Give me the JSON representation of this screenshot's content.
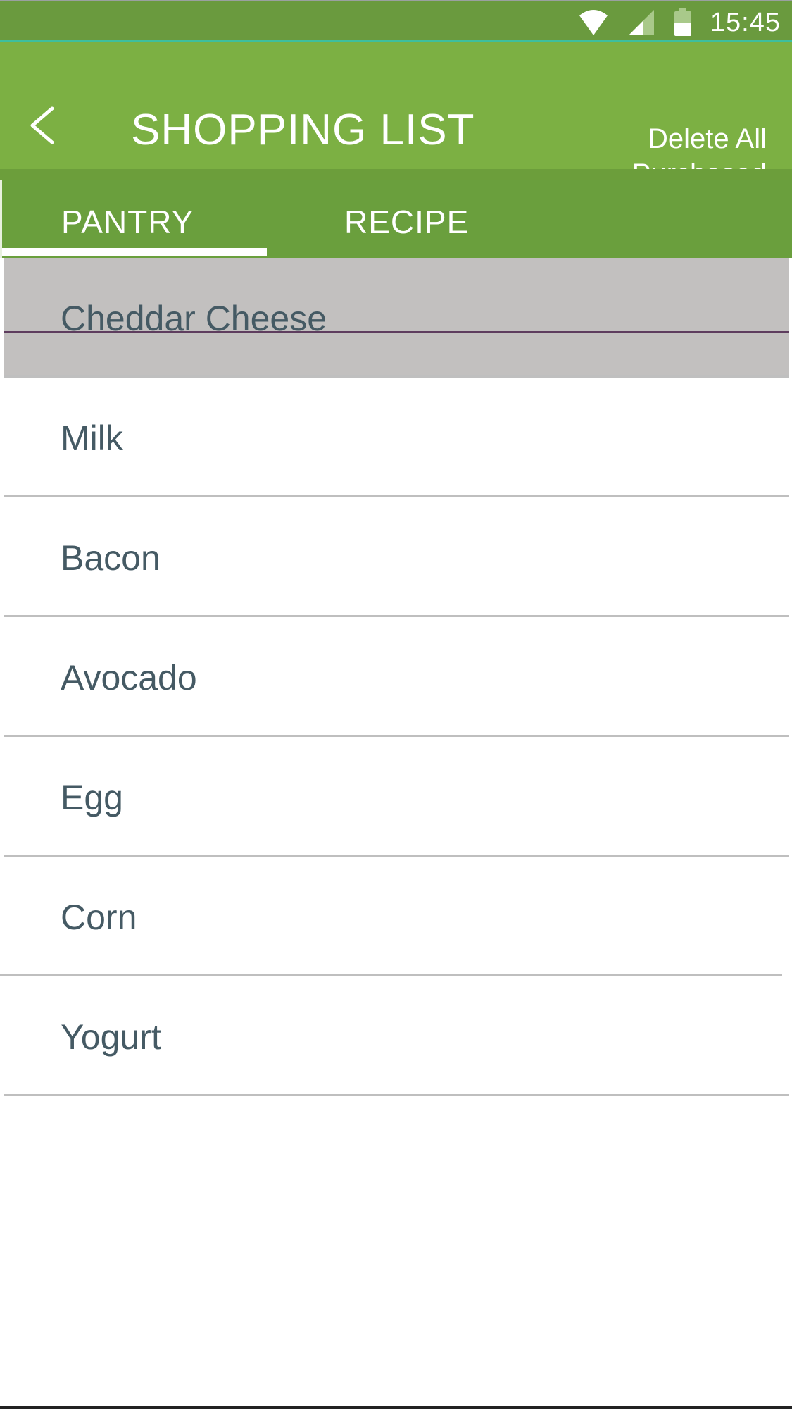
{
  "status_bar": {
    "time": "15:45",
    "icons": [
      "wifi-icon",
      "cellular-signal-icon",
      "battery-icon"
    ]
  },
  "app_bar": {
    "title": "SHOPPING LIST",
    "back_icon": "chevron-left-icon",
    "delete_all_line1": "Delete All",
    "delete_all_line2": "Purchased"
  },
  "tabs": [
    {
      "label": "PANTRY",
      "selected": true
    },
    {
      "label": "RECIPE",
      "selected": false
    }
  ],
  "items": [
    {
      "label": "Cheddar Cheese",
      "purchased": true
    },
    {
      "label": "Milk",
      "purchased": false
    },
    {
      "label": "Bacon",
      "purchased": false
    },
    {
      "label": "Avocado",
      "purchased": false
    },
    {
      "label": "Egg",
      "purchased": false
    },
    {
      "label": "Corn",
      "purchased": false
    },
    {
      "label": "Yogurt",
      "purchased": false
    }
  ],
  "colors": {
    "status_bar": "#6a9a3e",
    "app_bar": "#7cb043",
    "tab_bar": "#6a9f3d",
    "item_text": "#455a64",
    "purchased_bg": "#c2c0bf",
    "divider": "#bfbfbf"
  }
}
